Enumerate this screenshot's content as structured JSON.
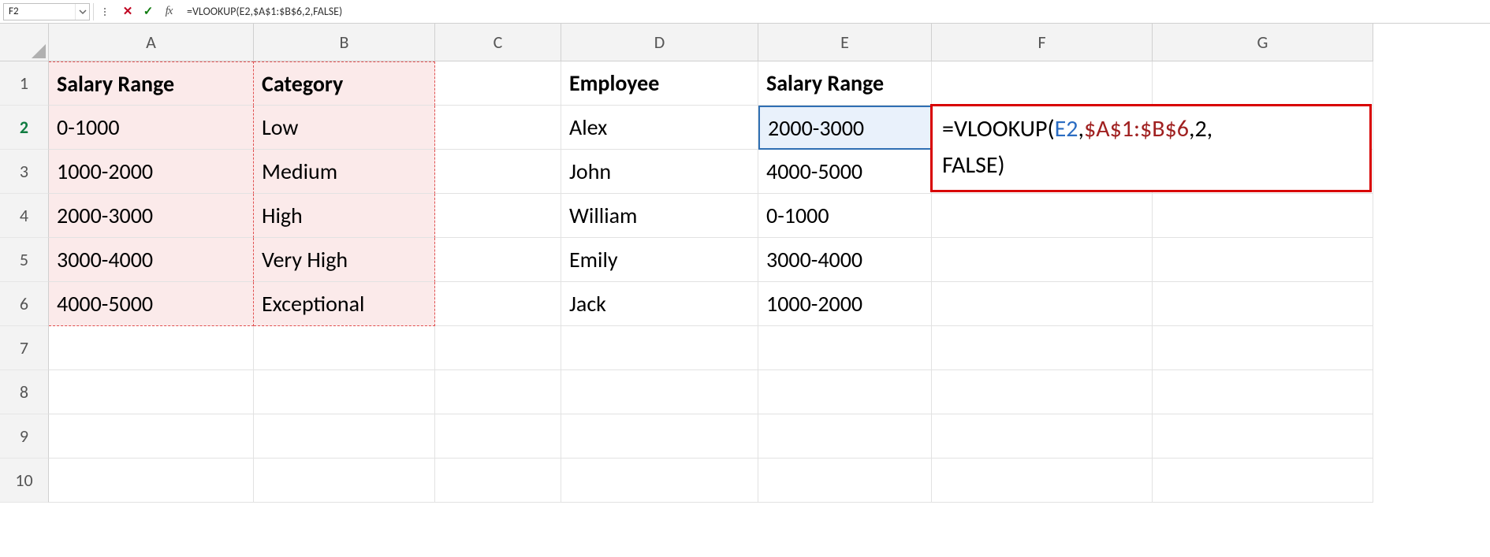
{
  "name_box": {
    "value": "F2"
  },
  "formula_bar": {
    "cancel_icon": "✕",
    "enter_icon": "✓",
    "fx_label": "fx",
    "formula": "=VLOOKUP(E2,$A$1:$B$6,2,FALSE)"
  },
  "columns": [
    "A",
    "B",
    "C",
    "D",
    "E",
    "F",
    "G"
  ],
  "rows": [
    "1",
    "2",
    "3",
    "4",
    "5",
    "6",
    "7",
    "8",
    "9",
    "10"
  ],
  "table1": {
    "header": {
      "c1": "Salary Range",
      "c2": "Category"
    },
    "rows": [
      {
        "c1": "0-1000",
        "c2": "Low"
      },
      {
        "c1": "1000-2000",
        "c2": "Medium"
      },
      {
        "c1": "2000-3000",
        "c2": "High"
      },
      {
        "c1": "3000-4000",
        "c2": "Very High"
      },
      {
        "c1": "4000-5000",
        "c2": "Exceptional"
      }
    ]
  },
  "table2": {
    "header": {
      "c1": "Employee",
      "c2": "Salary Range"
    },
    "rows": [
      {
        "c1": "Alex",
        "c2": "2000-3000"
      },
      {
        "c1": "John",
        "c2": "4000-5000"
      },
      {
        "c1": "William",
        "c2": "0-1000"
      },
      {
        "c1": "Emily",
        "c2": "3000-4000"
      },
      {
        "c1": "Jack",
        "c2": "1000-2000"
      }
    ]
  },
  "formula_bubble": {
    "pre": "=VLOOKUP(",
    "ref1": "E2",
    "comma1": ",",
    "ref2": "$A$1:$B$6",
    "comma2": ",",
    "num": "2",
    "comma3": ",",
    "tail": "FALSE)"
  }
}
